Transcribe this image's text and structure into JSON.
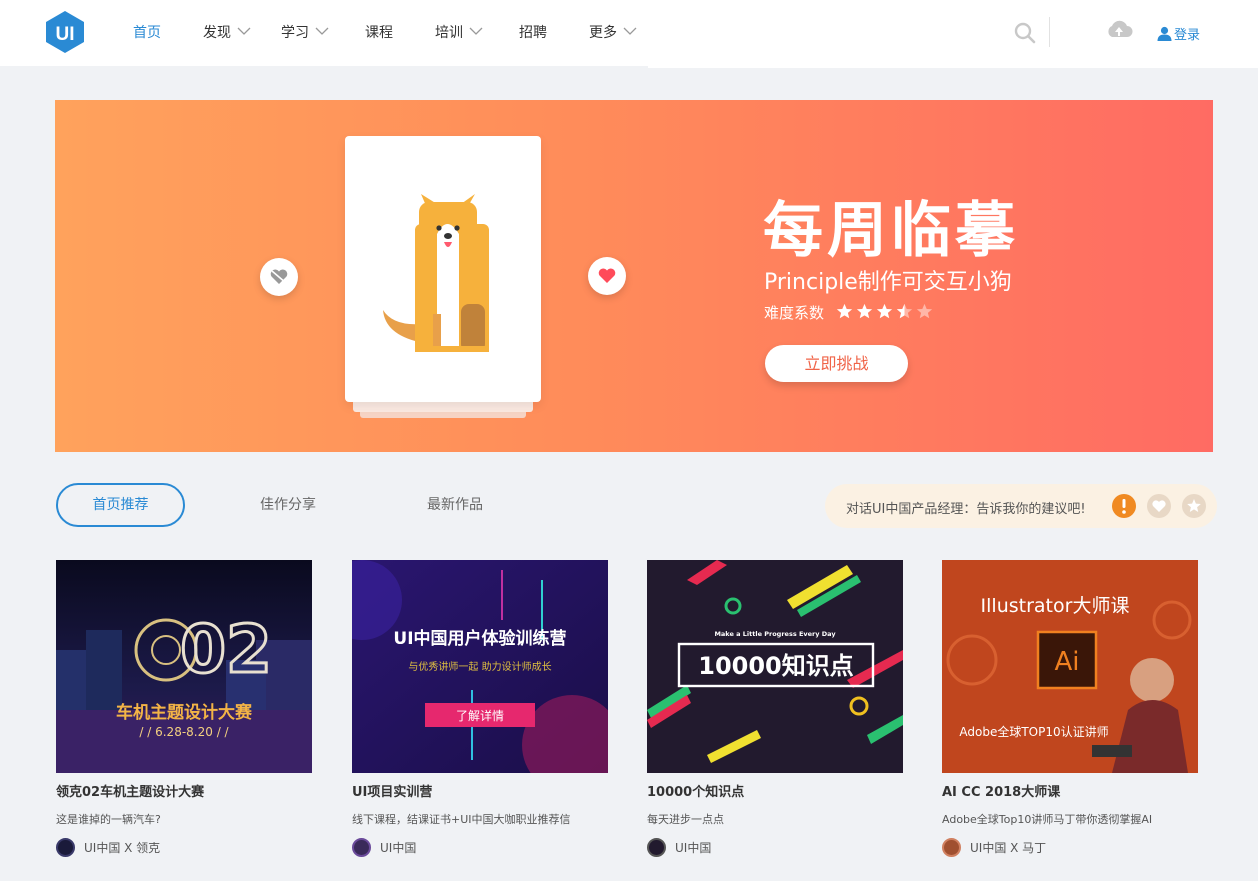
{
  "header": {
    "logo_text": "UI",
    "nav": [
      {
        "label": "首页",
        "active": true,
        "dropdown": false
      },
      {
        "label": "发现",
        "active": false,
        "dropdown": true
      },
      {
        "label": "学习",
        "active": false,
        "dropdown": true
      },
      {
        "label": "课程",
        "active": false,
        "dropdown": false
      },
      {
        "label": "培训",
        "active": false,
        "dropdown": true
      },
      {
        "label": "招聘",
        "active": false,
        "dropdown": false
      },
      {
        "label": "更多",
        "active": false,
        "dropdown": true
      }
    ],
    "login_label": "登录",
    "icons": [
      "search-icon",
      "cloud-icon",
      "user-icon"
    ]
  },
  "banner": {
    "title": "每周临摹",
    "subtitle": "Principle制作可交互小狗",
    "difficulty_label": "难度系数",
    "difficulty_rating": 3.5,
    "difficulty_max": 5,
    "cta_label": "立即挑战"
  },
  "tabs": [
    {
      "label": "首页推荐",
      "active": true
    },
    {
      "label": "佳作分享",
      "active": false
    },
    {
      "label": "最新作品",
      "active": false
    }
  ],
  "feedback": {
    "text": "对话UI中国产品经理：告诉我你的建议吧!"
  },
  "works": [
    {
      "title": "领克02车机主题设计大赛",
      "desc": "这是谁掉的一辆汽车?",
      "author": "UI中国 X 领克",
      "thumb_text": "车机主题设计大赛",
      "thumb_sub": "/ / 6.28-8.20 / /",
      "thumb_big": "02"
    },
    {
      "title": "UI项目实训营",
      "desc": "线下课程，结课证书+UI中国大咖职业推荐信",
      "author": "UI中国",
      "thumb_text": "UI中国用户体验训练营",
      "thumb_sub": "与优秀讲师一起 助力设计师成长",
      "thumb_btn": "了解详情"
    },
    {
      "title": "10000个知识点",
      "desc": "每天进步一点点",
      "author": "UI中国",
      "thumb_text": "10000知识点",
      "thumb_sub": "Make a Little Progress Every Day"
    },
    {
      "title": "AI CC 2018大师课",
      "desc": "Adobe全球Top10讲师马丁带你透彻掌握AI",
      "author": "UI中国 X 马丁",
      "thumb_text": "Illustrator大师课",
      "thumb_badge": "Ai",
      "thumb_sub": "Adobe全球TOP10认证讲师"
    }
  ],
  "colors": {
    "accent": "#2a8ad4",
    "banner_from": "#ffa25c",
    "banner_to": "#ff6b63",
    "cta_text": "#f06448",
    "feedback_bg": "#fbf1e3"
  }
}
